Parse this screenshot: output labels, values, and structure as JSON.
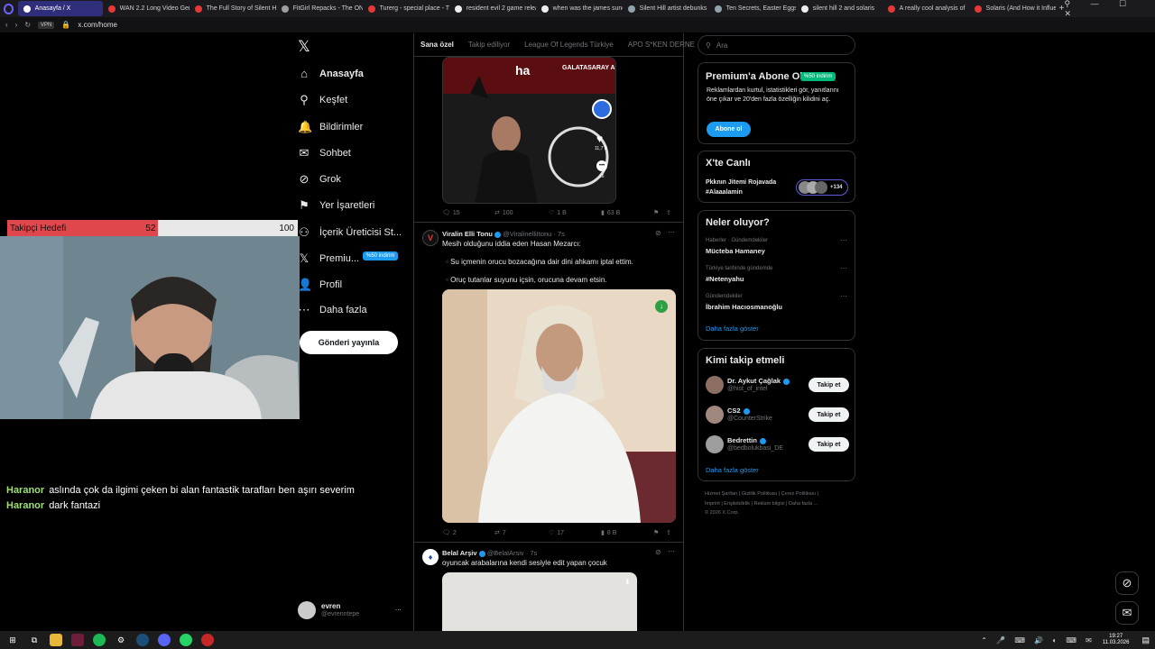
{
  "browser": {
    "tabs": [
      {
        "title": "Anasayfa / X",
        "color": "#ffffff"
      },
      {
        "title": "WAN 2.2 Long Video Gen",
        "color": "#e53935"
      },
      {
        "title": "The Full Story of Silent Hill",
        "color": "#e53935"
      },
      {
        "title": "FitGirl Repacks - The ON",
        "color": "#9e9e9e"
      },
      {
        "title": "Turerg - special place - T",
        "color": "#e53935"
      },
      {
        "title": "resident evil 2 game relea",
        "color": "#eeeeee"
      },
      {
        "title": "when was the james sund",
        "color": "#eeeeee"
      },
      {
        "title": "Silent Hill artist debunks",
        "color": "#90a4ae"
      },
      {
        "title": "Ten Secrets, Easter Eggs",
        "color": "#90a4ae"
      },
      {
        "title": "silent hill 2 and solaris",
        "color": "#eeeeee"
      },
      {
        "title": "A really cool analysis of",
        "color": "#e53935"
      },
      {
        "title": "Solaris (And How it Influe",
        "color": "#e53935"
      }
    ],
    "new_tab": "+",
    "vpn_label": "VPN",
    "url": "x.com/home"
  },
  "sidebar": {
    "logo": "𝕏",
    "items": [
      {
        "label": "Anasayfa",
        "icon": "⌂"
      },
      {
        "label": "Keşfet",
        "icon": "⚲"
      },
      {
        "label": "Bildirimler",
        "icon": "🔔"
      },
      {
        "label": "Sohbet",
        "icon": "✉"
      },
      {
        "label": "Grok",
        "icon": "⊘"
      },
      {
        "label": "Yer İşaretleri",
        "icon": "⚑"
      },
      {
        "label": "İçerik Üreticisi St...",
        "icon": "⚇"
      },
      {
        "label": "Premiu...",
        "icon": "𝕏"
      },
      {
        "label": "Profil",
        "icon": "👤"
      },
      {
        "label": "Daha fazla",
        "icon": "⋯"
      }
    ],
    "premium_badge": "%50 indirim",
    "post_button": "Gönderi yayınla",
    "account": {
      "name": "evren",
      "handle": "@evrenntepe",
      "more": "..."
    }
  },
  "stream": {
    "goal_label": "Takipçi Hedefi",
    "goal_current": "52",
    "goal_target": "100",
    "goal_fraction": 0.52,
    "chat": [
      {
        "user": "Haranor",
        "text": "aslında çok da ilgimi çeken bi alan fantastik tarafları ben aşırı severim"
      },
      {
        "user": "Haranor",
        "text": "dark fantazi"
      }
    ]
  },
  "feed": {
    "tabs": [
      "Sana özel",
      "Takip ediliyor",
      "League Of Legends Türkiye",
      "APO S*KEN DERNE"
    ],
    "posts": [
      {
        "image_text": "ha",
        "image_banner": "GALATASARAY A",
        "side_like_count": "11,7 B",
        "side_comment_count": "16",
        "stats": {
          "replies": "15",
          "reposts": "100",
          "likes": "1 B",
          "views": "63 B"
        }
      },
      {
        "author": "Viralin Elli Tonu",
        "handle": "@ViralinelliItonu",
        "time": "7s",
        "text": "Mesih olduğunu iddia eden Hasan Mezarcı:",
        "bullets": [
          "Su içmenin orucu bozacağına dair dini ahkamı iptal ettim.",
          "Oruç tutanlar suyunu içsin, orucuna devam etsin."
        ],
        "stats": {
          "replies": "2",
          "reposts": "7",
          "likes": "17",
          "views": "8 B"
        }
      },
      {
        "author": "Belal Arşiv",
        "handle": "@BelalArsiv",
        "time": "7s",
        "text": "oyuncak arabalarına kendi sesiyle edit yapan çocuk"
      }
    ]
  },
  "right": {
    "search_placeholder": "Ara",
    "premium": {
      "title": "Premium'a Abone Ol",
      "badge": "%50 indirim",
      "text": "Reklamlardan kurtul, istatistikleri gör, yanıtlarını öne çıkar ve 20'den fazla özelliğin kilidini aç.",
      "button": "Abone ol"
    },
    "live": {
      "title": "X'te Canlı",
      "stream_title": "Pkknın Jitemi Rojavada",
      "stream_tag": "#Alaaalamin",
      "extra_count": "+134"
    },
    "trends": {
      "title": "Neler oluyor?",
      "items": [
        {
          "category": "Haberler · Gündemdekiler",
          "name": "Müctеba Hamaney"
        },
        {
          "category": "Türkiye tarihinde gündemde",
          "name": "#Netenyahu"
        },
        {
          "category": "Gündemdekiler",
          "name": "İbrahim Hacıosmanoğlu"
        }
      ],
      "show_more": "Daha fazla göster"
    },
    "who_to_follow": {
      "title": "Kimi takip etmeli",
      "items": [
        {
          "name": "Dr. Aykut Çağlak",
          "handle": "@hist_of_intel",
          "button": "Takip et",
          "color": "#8d6e63"
        },
        {
          "name": "CS2",
          "handle": "@CounterStrike",
          "button": "Takip et",
          "color": "#a1887f"
        },
        {
          "name": "Bedrettin",
          "handle": "@bedbolukbasi_DE",
          "button": "Takip et",
          "color": "#9e9e9e"
        }
      ],
      "show_more": "Daha fazla göster"
    },
    "footer": {
      "line1": "Hizmet Şartları  |  Gizlilik Politikası  |  Çerez Politikası  |",
      "line2": "İmprint  |  Erişilebilirlik  |  Reklam bilgisi  |  Daha fazla ...",
      "line3": "© 2026 X Corp."
    }
  },
  "taskbar": {
    "time": "19:27",
    "date": "11.03.2026"
  },
  "colors": {
    "accent": "#1d9bf0",
    "goal_fill": "#e0474c",
    "chat_user": "#9fe07a",
    "badge_green": "#00ba7c"
  }
}
